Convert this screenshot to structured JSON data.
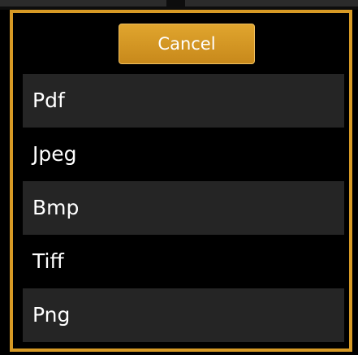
{
  "dialog": {
    "cancel_label": "Cancel",
    "options": [
      {
        "label": "Pdf"
      },
      {
        "label": "Jpeg"
      },
      {
        "label": "Bmp"
      },
      {
        "label": "Tiff"
      },
      {
        "label": "Png"
      }
    ]
  },
  "colors": {
    "accent": "#d79a25",
    "button": "#d89b24",
    "row_shaded": "#252525",
    "background": "#000000",
    "text": "#ffffff"
  }
}
